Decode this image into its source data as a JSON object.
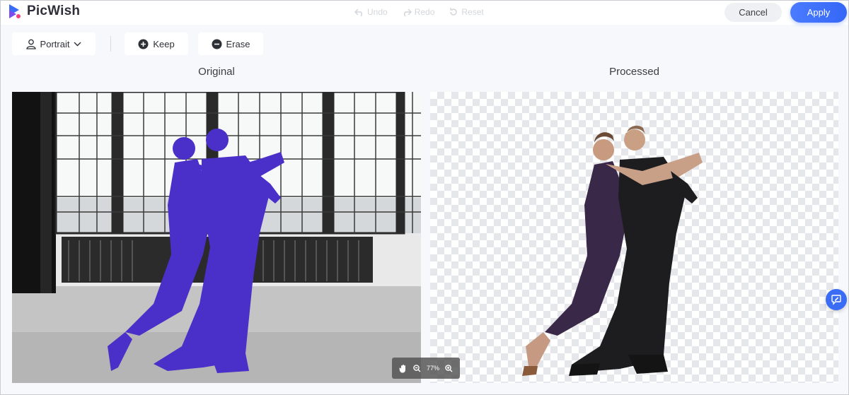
{
  "app": {
    "name": "PicWish",
    "brand_color": "#3a6cf6"
  },
  "header": {
    "undo_label": "Undo",
    "redo_label": "Redo",
    "reset_label": "Reset",
    "cancel_label": "Cancel",
    "apply_label": "Apply"
  },
  "toolbar": {
    "mode_label": "Portrait",
    "keep_label": "Keep",
    "erase_label": "Erase"
  },
  "panels": {
    "original_label": "Original",
    "processed_label": "Processed"
  },
  "zoom": {
    "level": "77%"
  },
  "icons": {
    "logo": "picwish-logo-icon",
    "undo": "undo-icon",
    "redo": "redo-icon",
    "reset": "reset-icon",
    "portrait": "person-icon",
    "dropdown": "chevron-down-icon",
    "keep": "plus-circle-icon",
    "erase": "minus-circle-icon",
    "pan": "hand-icon",
    "zoom_out": "zoom-out-icon",
    "zoom_in": "zoom-in-icon",
    "feedback": "feedback-icon"
  }
}
